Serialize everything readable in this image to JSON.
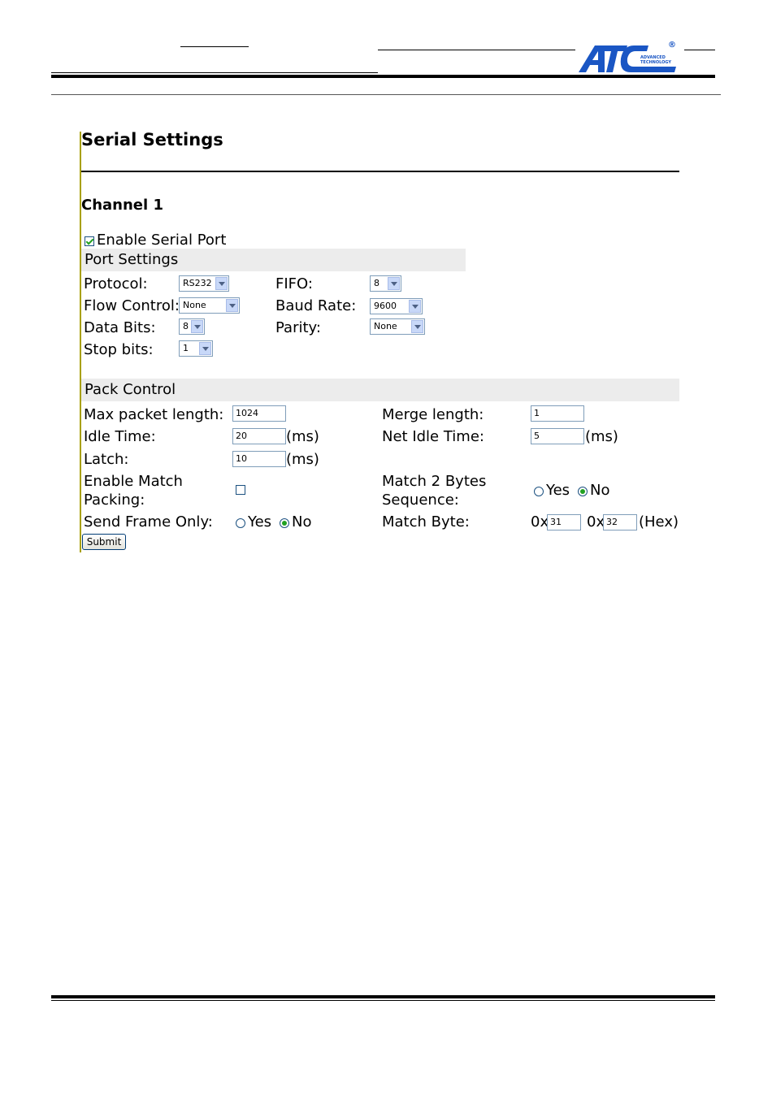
{
  "page": {
    "title": "Serial Settings",
    "channel": "Channel 1"
  },
  "logo": {
    "text": "ATC",
    "line1": "ADVANCED",
    "line2": "TECHNOLOGY",
    "registered": "®",
    "color": "#1a56c4"
  },
  "enable_serial_port": {
    "label": "Enable Serial Port",
    "checked": true
  },
  "port_settings": {
    "heading": "Port Settings",
    "protocol": {
      "label": "Protocol:",
      "value": "RS232"
    },
    "fifo": {
      "label": "FIFO:",
      "value": "8"
    },
    "flow_control": {
      "label": "Flow Control:",
      "value": "None"
    },
    "baud_rate": {
      "label": "Baud Rate:",
      "value": "9600"
    },
    "data_bits": {
      "label": "Data Bits:",
      "value": "8"
    },
    "parity": {
      "label": "Parity:",
      "value": "None"
    },
    "stop_bits": {
      "label": "Stop bits:",
      "value": "1"
    }
  },
  "pack_control": {
    "heading": "Pack Control",
    "max_packet_length": {
      "label": "Max packet length:",
      "value": "1024"
    },
    "merge_length": {
      "label": "Merge length:",
      "value": "1"
    },
    "idle_time": {
      "label": "Idle Time:",
      "value": "20",
      "unit": "(ms)"
    },
    "net_idle_time": {
      "label": "Net Idle Time:",
      "value": "5",
      "unit": "(ms)"
    },
    "latch": {
      "label": "Latch:",
      "value": "10",
      "unit": "(ms)"
    },
    "enable_match_packing": {
      "label_line1": "Enable Match",
      "label_line2": "Packing:",
      "checked": false
    },
    "match_2_bytes": {
      "label_line1": "Match 2 Bytes",
      "label_line2": "Sequence:",
      "yes": "Yes",
      "no": "No",
      "selected": "No"
    },
    "send_frame_only": {
      "label": "Send Frame Only:",
      "yes": "Yes",
      "no": "No",
      "selected": "No"
    },
    "match_byte": {
      "label": "Match Byte:",
      "prefix1": "0x",
      "value1": "31",
      "prefix2": "0x",
      "value2": "32",
      "suffix": "(Hex)"
    }
  },
  "submit": {
    "label": "Submit"
  }
}
